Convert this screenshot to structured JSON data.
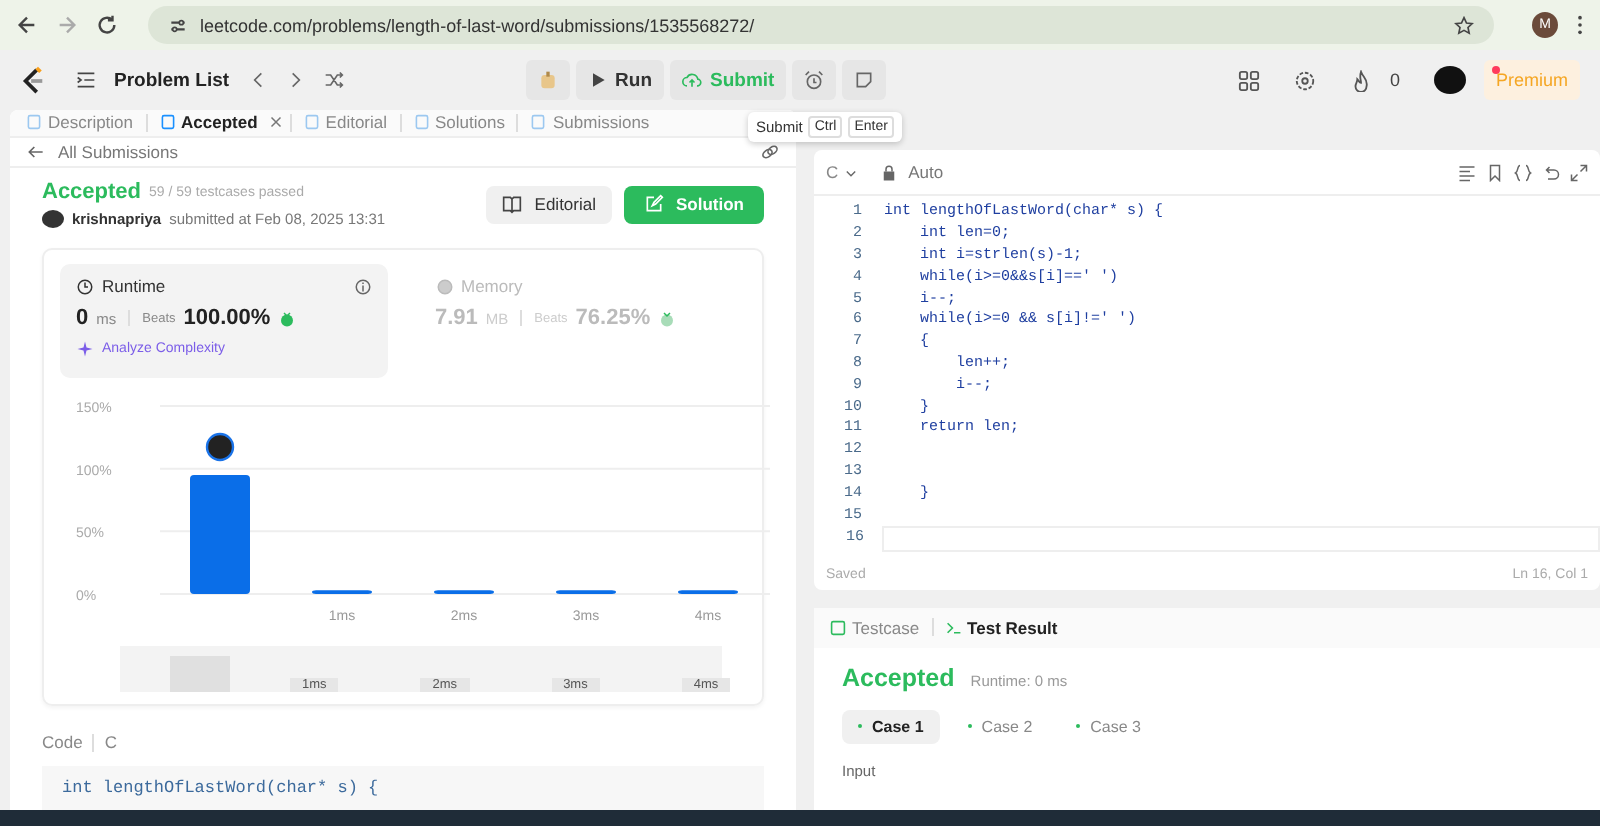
{
  "browser": {
    "url": "leetcode.com/problems/length-of-last-word/submissions/1535568272/",
    "profile_initial": "M"
  },
  "nav": {
    "problem_list": "Problem List",
    "run": "Run",
    "submit": "Submit",
    "streak": "0",
    "premium": "Premium",
    "has_notification": true
  },
  "tooltip": {
    "label": "Submit",
    "keys": [
      "Ctrl",
      "Enter"
    ]
  },
  "left_tabs": [
    {
      "label": "Description",
      "selected": false,
      "closable": false
    },
    {
      "label": "Accepted",
      "selected": true,
      "closable": true
    },
    {
      "label": "Editorial",
      "selected": false,
      "closable": false
    },
    {
      "label": "Solutions",
      "selected": false,
      "closable": false
    },
    {
      "label": "Submissions",
      "selected": false,
      "closable": false
    }
  ],
  "back_link": "All Submissions",
  "submission": {
    "status": "Accepted",
    "testcases": "59 / 59 testcases passed",
    "user": "krishnapriya",
    "submitted": "submitted at Feb 08, 2025 13:31",
    "editorial_button": "Editorial",
    "solution_button": "Solution"
  },
  "metrics": [
    {
      "title": "Runtime",
      "value": "0",
      "unit": "ms",
      "beats_label": "Beats",
      "beats": "100.00%",
      "selected": true
    },
    {
      "title": "Memory",
      "value": "7.91",
      "unit": "MB",
      "beats_label": "Beats",
      "beats": "76.25%",
      "selected": false
    }
  ],
  "analyze": "Analyze Complexity",
  "chart_data": {
    "type": "bar",
    "categories": [
      null,
      "1ms",
      "2ms",
      "3ms",
      "4ms"
    ],
    "values": [
      95,
      3,
      3,
      3,
      3
    ],
    "ylim": [
      0,
      150
    ],
    "yticks": [
      {
        "value": 0,
        "label": "0%"
      },
      {
        "value": 50,
        "label": "50%"
      },
      {
        "value": 100,
        "label": "100%"
      },
      {
        "value": 150,
        "label": "150%"
      }
    ]
  },
  "navigator_labels": [
    "1ms",
    "2ms",
    "3ms",
    "4ms"
  ],
  "code_section": {
    "label": "Code",
    "language": "C",
    "preview": "int lengthOfLastWord(char* s) {"
  },
  "editor": {
    "language": "C",
    "mode": "Auto",
    "lines": [
      {
        "n": "1",
        "text": "int lengthOfLastWord(char* s) {"
      },
      {
        "n": "2",
        "text": "    int len=0;"
      },
      {
        "n": "3",
        "text": "    int i=strlen(s)-1;"
      },
      {
        "n": "4",
        "text": "    while(i>=0&&s[i]==' ')"
      },
      {
        "n": "5",
        "text": "    i--;"
      },
      {
        "n": "6",
        "text": "    while(i>=0 && s[i]!=' ')"
      },
      {
        "n": "7",
        "text": "    {"
      },
      {
        "n": "8",
        "text": "        len++;"
      },
      {
        "n": "9",
        "text": "        i--;"
      },
      {
        "n": "10",
        "text": "    }"
      },
      {
        "n": "11",
        "text": "    return len;"
      },
      {
        "n": "12"
      },
      {
        "n": "13"
      },
      {
        "n": "14",
        "text": "    }"
      },
      {
        "n": "15"
      },
      {
        "n": "16",
        "current": true
      }
    ],
    "status": "Saved",
    "cursor": "Ln 16, Col 1"
  },
  "result_tabs": [
    {
      "label": "Testcase",
      "selected": false
    },
    {
      "label": "Test Result",
      "selected": true
    }
  ],
  "result": {
    "status": "Accepted",
    "runtime": "Runtime: 0 ms",
    "cases": [
      {
        "label": "Case 1",
        "selected": true
      },
      {
        "label": "Case 2",
        "selected": false
      },
      {
        "label": "Case 3",
        "selected": false
      }
    ],
    "input_label": "Input"
  }
}
